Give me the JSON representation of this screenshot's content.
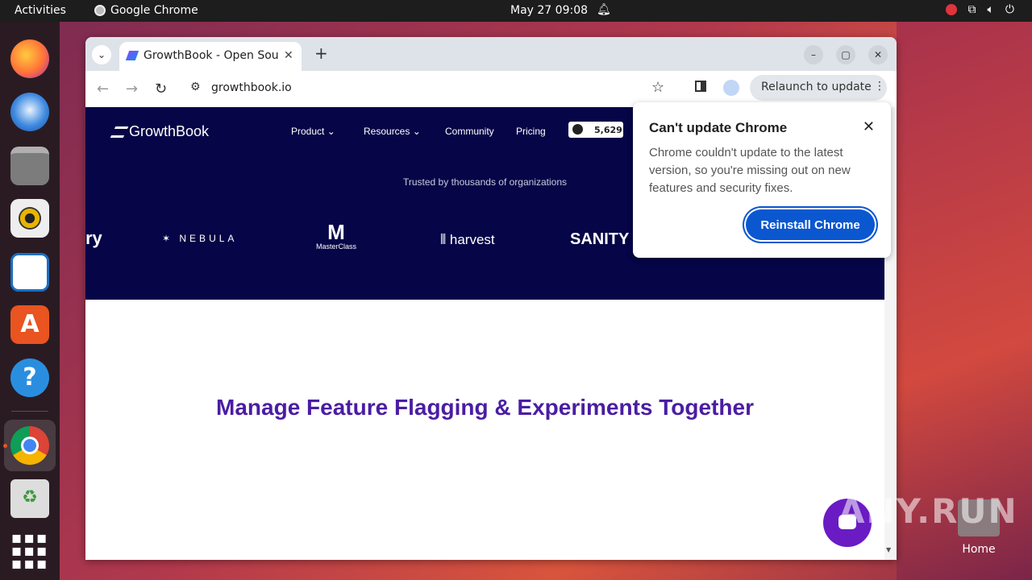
{
  "topbar": {
    "activities": "Activities",
    "app_name": "Google Chrome",
    "clock": "May 27  09:08"
  },
  "dock": {
    "items": [
      "firefox-icon",
      "thunderbird-icon",
      "files-icon",
      "rhythmbox-icon",
      "writer-icon",
      "app-center-icon",
      "help-icon",
      "chrome-icon",
      "trash-icon",
      "app-grid-icon"
    ]
  },
  "desktop": {
    "home_label": "Home"
  },
  "chrome": {
    "tab_title": "GrowthBook - Open Sou",
    "url": "growthbook.io",
    "relaunch_label": "Relaunch to update"
  },
  "site": {
    "logo": "GrowthBook",
    "nav": [
      "Product",
      "Resources",
      "Community",
      "Pricing"
    ],
    "github_stars": "5,629",
    "trusted": "Trusted by thousands of organizations",
    "brands": [
      "ry",
      "NEBULA",
      "MasterClass",
      "harvest",
      "SANITY"
    ],
    "headline": "Manage Feature Flagging & Experiments Together"
  },
  "popup": {
    "title": "Can't update Chrome",
    "body": "Chrome couldn't update to the latest version, so you're missing out on new features and security fixes.",
    "button": "Reinstall Chrome"
  },
  "watermark": "ANY.RUN",
  "colors": {
    "hero_bg": "#050547",
    "headline": "#4a1da3",
    "reinstall_button": "#0b57d0",
    "ubuntu_accent": "#e95420"
  }
}
